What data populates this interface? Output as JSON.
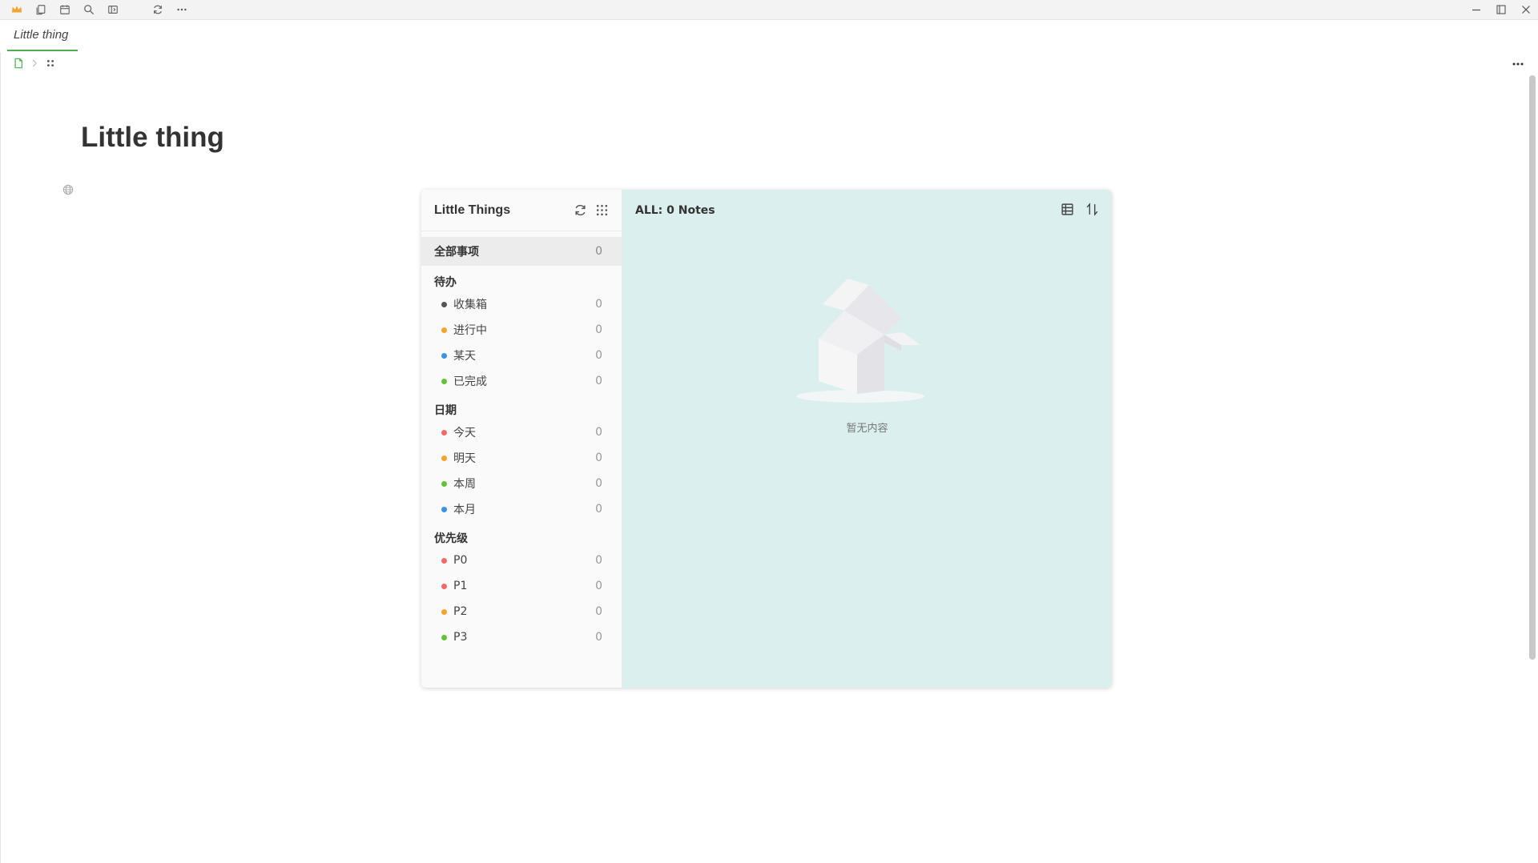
{
  "titlebar": {
    "left_icons": [
      "crown-icon",
      "copy-icon",
      "calendar-icon",
      "search-icon",
      "panel-icon",
      "sync-icon",
      "more-icon"
    ],
    "window_controls": [
      "minimize-icon",
      "maximize-icon",
      "close-icon"
    ]
  },
  "tab": {
    "label": "Little thing"
  },
  "breadcrumb": {
    "icons": [
      "document-icon",
      "chevron-right-icon",
      "grid-dots-icon"
    ]
  },
  "page": {
    "title": "Little thing"
  },
  "widget": {
    "title": "Little Things",
    "all": {
      "label": "全部事项",
      "count": "0"
    },
    "groups": [
      {
        "title": "待办",
        "items": [
          {
            "label": "收集箱",
            "count": "0",
            "color": "#555555"
          },
          {
            "label": "进行中",
            "count": "0",
            "color": "#f0a431"
          },
          {
            "label": "某天",
            "count": "0",
            "color": "#3f8fe3"
          },
          {
            "label": "已完成",
            "count": "0",
            "color": "#67c23a"
          }
        ]
      },
      {
        "title": "日期",
        "items": [
          {
            "label": "今天",
            "count": "0",
            "color": "#ee6b6b"
          },
          {
            "label": "明天",
            "count": "0",
            "color": "#f0a431"
          },
          {
            "label": "本周",
            "count": "0",
            "color": "#67c23a"
          },
          {
            "label": "本月",
            "count": "0",
            "color": "#3f8fe3"
          }
        ]
      },
      {
        "title": "优先级",
        "items": [
          {
            "label": "P0",
            "count": "0",
            "color": "#ee6b6b"
          },
          {
            "label": "P1",
            "count": "0",
            "color": "#ee6b6b"
          },
          {
            "label": "P2",
            "count": "0",
            "color": "#f0a431"
          },
          {
            "label": "P3",
            "count": "0",
            "color": "#67c23a"
          }
        ]
      }
    ],
    "main": {
      "stat": "ALL: 0 Notes",
      "empty_text": "暂无内容",
      "background": "#daefee"
    }
  }
}
